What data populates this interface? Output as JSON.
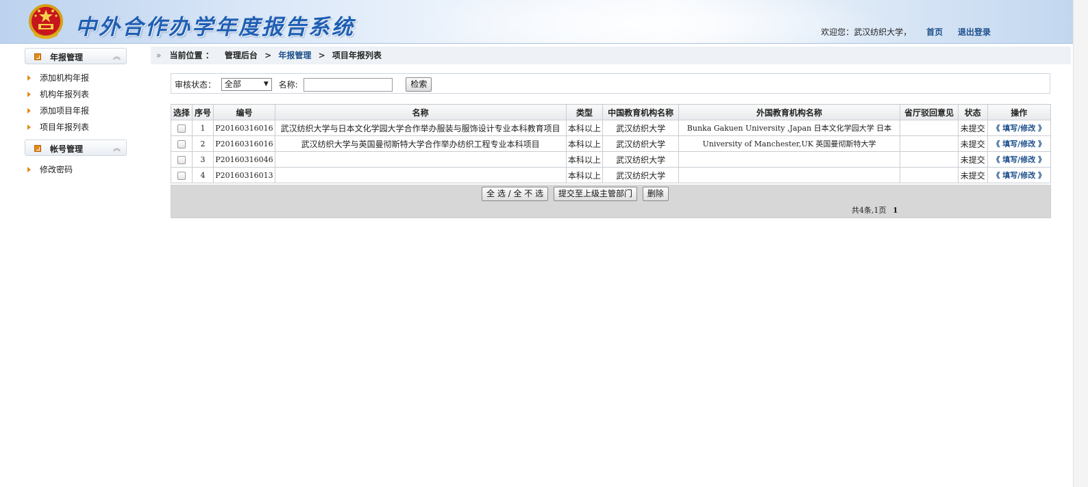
{
  "header": {
    "title": "中外合作办学年度报告系统",
    "welcome": "欢迎您：武汉纺织大学，",
    "home_link": "首页",
    "logout_link": "退出登录"
  },
  "sidebar": {
    "groups": [
      {
        "title": "年报管理",
        "items": [
          "添加机构年报",
          "机构年报列表",
          "添加项目年报",
          "项目年报列表"
        ]
      },
      {
        "title": "帐号管理",
        "items": [
          "修改密码"
        ]
      }
    ],
    "collapse_glyph": "︽"
  },
  "breadcrumb": {
    "prefix": "当前位置 ：",
    "items": [
      "管理后台",
      "年报管理",
      "项目年报列表"
    ]
  },
  "search": {
    "status_label": "审核状态：",
    "status_value": "全部",
    "name_label": "名称:",
    "name_value": "",
    "search_button": "检索"
  },
  "table": {
    "columns": [
      "选择",
      "序号",
      "编号",
      "名称",
      "类型",
      "中国教育机构名称",
      "外国教育机构名称",
      "省厅驳回意见",
      "状态",
      "操作"
    ],
    "rows": [
      {
        "index": "1",
        "code": "P20160316016",
        "name": "武汉纺织大学与日本文化学园大学合作举办服装与服饰设计专业本科教育项目",
        "type": "本科以上",
        "cn_institution": "武汉纺织大学",
        "foreign_institution": "Bunka Gakuen University ,Japan 日本文化学园大学 日本",
        "rejection": "",
        "status": "未提交",
        "action": "《 填写/修改 》"
      },
      {
        "index": "2",
        "code": "P20160316016",
        "name": "武汉纺织大学与英国曼彻斯特大学合作举办纺织工程专业本科项目",
        "type": "本科以上",
        "cn_institution": "武汉纺织大学",
        "foreign_institution": "University of Manchester,UK 英国曼彻斯特大学",
        "rejection": "",
        "status": "未提交",
        "action": "《 填写/修改 》"
      },
      {
        "index": "3",
        "code": "P20160316046",
        "name": "",
        "type": "本科以上",
        "cn_institution": "武汉纺织大学",
        "foreign_institution": "",
        "rejection": "",
        "status": "未提交",
        "action": "《 填写/修改 》"
      },
      {
        "index": "4",
        "code": "P20160316013",
        "name": "",
        "type": "本科以上",
        "cn_institution": "武汉纺织大学",
        "foreign_institution": "",
        "rejection": "",
        "status": "未提交",
        "action": "《 填写/修改 》"
      }
    ]
  },
  "actions": {
    "select_all": "全 选 / 全 不 选",
    "submit": "提交至上级主管部门",
    "delete": "删除",
    "pager_summary": "共4条,1页",
    "current_page": "1"
  }
}
